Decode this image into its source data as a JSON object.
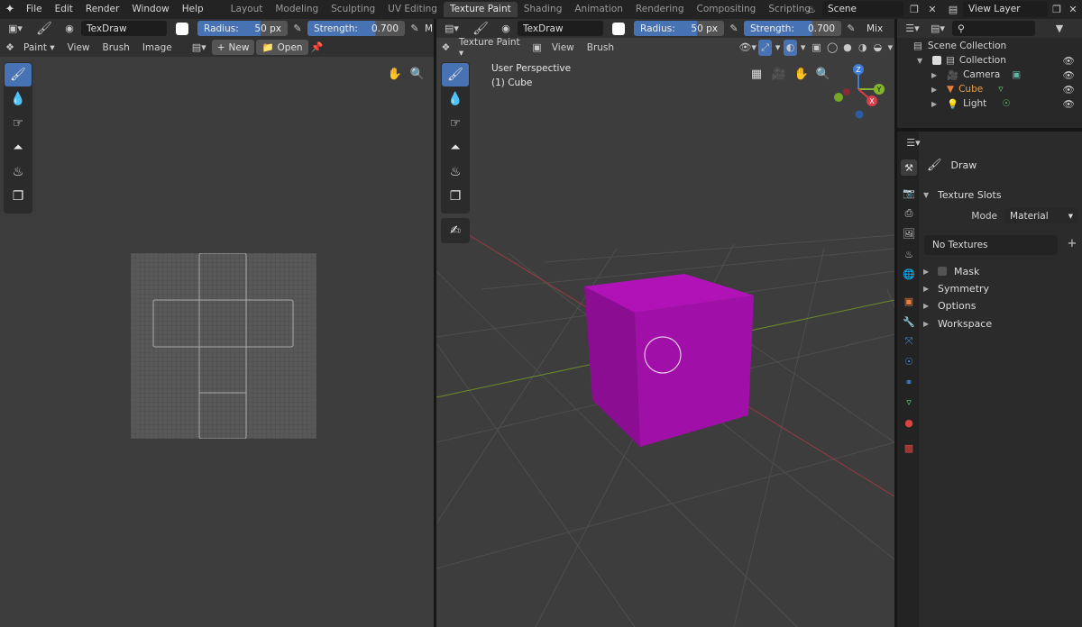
{
  "menu": [
    "File",
    "Edit",
    "Render",
    "Window",
    "Help"
  ],
  "workspaces": [
    {
      "label": "Layout",
      "active": false
    },
    {
      "label": "Modeling",
      "active": false
    },
    {
      "label": "Sculpting",
      "active": false
    },
    {
      "label": "UV Editing",
      "active": false
    },
    {
      "label": "Texture Paint",
      "active": true
    },
    {
      "label": "Shading",
      "active": false
    },
    {
      "label": "Animation",
      "active": false
    },
    {
      "label": "Rendering",
      "active": false
    },
    {
      "label": "Compositing",
      "active": false
    },
    {
      "label": "Scripting",
      "active": false
    }
  ],
  "scene_name": "Scene",
  "view_layer_name": "View Layer",
  "image_editor": {
    "brush_name": "TexDraw",
    "radius_label": "Radius:",
    "radius_value": "50 px",
    "strength_label": "Strength:",
    "strength_value": "0.700",
    "mode_label": "Paint",
    "menus": [
      "View",
      "Brush",
      "Image"
    ],
    "new_label": "New",
    "open_label": "Open",
    "trunc": "M"
  },
  "viewport": {
    "brush_name": "TexDraw",
    "radius_label": "Radius:",
    "radius_value": "50 px",
    "strength_label": "Strength:",
    "strength_value": "0.700",
    "blend": "Mix",
    "mode_label": "Texture Paint",
    "menus": [
      "View",
      "Brush"
    ],
    "perspective": "User Perspective",
    "object": "(1) Cube",
    "cube_color": "#a010a8",
    "gizmo": {
      "x": "X",
      "y": "Y",
      "z": "Z"
    }
  },
  "outliner": {
    "root": "Scene Collection",
    "collection": "Collection",
    "items": [
      {
        "name": "Camera",
        "color": "#e87d3e"
      },
      {
        "name": "Cube",
        "color": "#e87d3e"
      },
      {
        "name": "Light",
        "color": "#e87d3e"
      }
    ]
  },
  "properties": {
    "tool_name": "Draw",
    "texture_slots_label": "Texture Slots",
    "mode_label": "Mode",
    "mode_value": "Material",
    "no_textures": "No Textures",
    "mask_label": "Mask",
    "sections": [
      "Symmetry",
      "Options",
      "Workspace"
    ]
  },
  "colors": {
    "accent": "#4772b3",
    "object_orange": "#e87d3e"
  }
}
